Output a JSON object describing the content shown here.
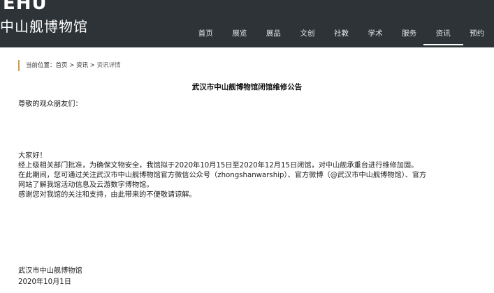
{
  "header": {
    "logo_en": "EHU",
    "logo_cn": "中山舰博物馆",
    "nav": [
      "首页",
      "展览",
      "展品",
      "文创",
      "社教",
      "学术",
      "服务",
      "资讯",
      "预约"
    ],
    "active_nav": "资讯"
  },
  "breadcrumb": {
    "prefix": "当前位置：",
    "home": "首页",
    "sep1": " > ",
    "news": "资讯",
    "sep2": " > ",
    "current": "资讯详情"
  },
  "article": {
    "title": "武汉市中山舰博物馆闭馆维修公告",
    "greeting": "尊敬的观众朋友们：",
    "hello": "大家好！",
    "lines": [
      "经上级相关部门批准，为确保文物安全，我馆拟于2020年10月15日至2020年12月15日闭馆，对中山舰承重台进行维修加固。",
      "在此期间，您可通过关注武汉市中山舰博物馆官方微信公众号（zhongshanwarship）、官方微博（@武汉市中山舰博物馆）、官方",
      "网站了解我馆活动信息及云游数字博物馆。",
      "感谢您对我馆的关注和支持，由此带来的不便敬请谅解。"
    ],
    "signature": "武汉市中山舰博物馆",
    "date": "2020年10月1日"
  }
}
